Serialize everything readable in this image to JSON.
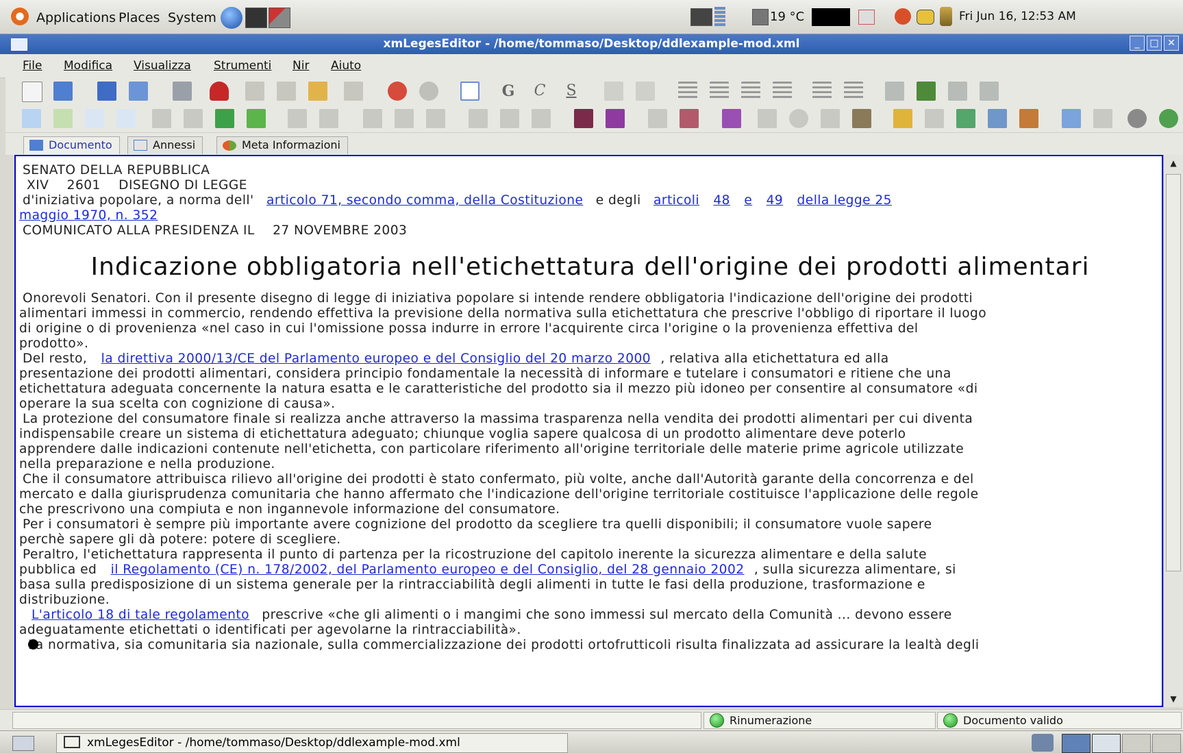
{
  "panel": {
    "menus": [
      "Applications",
      "Places",
      "System"
    ],
    "temperature": "19 °C",
    "clock": "Fri Jun 16, 12:53 AM"
  },
  "window": {
    "title": "xmLegesEditor - /home/tommaso/Desktop/ddlexample-mod.xml"
  },
  "menubar": [
    "File",
    "Modifica",
    "Visualizza",
    "Strumenti",
    "Nir",
    "Aiuto"
  ],
  "toolbar": {
    "format_letters": [
      "G",
      "C",
      "S"
    ]
  },
  "tabs": [
    "Documento",
    "Annessi",
    "Meta Informazioni"
  ],
  "document": {
    "header1": "SENATO DELLA REPUBBLICA",
    "leg": "XIV",
    "num": "2601",
    "type": "DISEGNO DI LEGGE",
    "initiative_pre": "d'iniziativa popolare, a norma dell'",
    "link_costituzione": "articolo 71, secondo comma, della Costituzione",
    "initiative_mid": "e degli",
    "link_articoli": "articoli",
    "link_48": "48",
    "link_e": "e",
    "link_49": "49",
    "link_legge": "della legge 25",
    "link_legge_cont": "maggio 1970, n. 352",
    "comunicato_label": "COMUNICATO ALLA PRESIDENZA IL",
    "comunicato_date": "27 NOVEMBRE 2003",
    "title": "Indicazione obbligatoria nell'etichettatura dell'origine dei prodotti alimentari",
    "p1_l1": "Onorevoli Senatori. Con il presente disegno di legge di iniziativa popolare si intende rendere obbligatoria l'indicazione dell'origine dei prodotti",
    "p1_l2": "alimentari immessi in commercio, rendendo effettiva la previsione della normativa sulla etichettatura che prescrive l'obbligo di riportare il luogo",
    "p1_l3": "di origine o di provenienza «nel caso in cui l'omissione possa indurre in errore l'acquirente circa l'origine o la provenienza effettiva del",
    "p1_l4": "prodotto».",
    "p2_pre": "Del resto,",
    "p2_link": "la direttiva 2000/13/CE del Parlamento europeo e del Consiglio del 20 marzo 2000",
    "p2_post": ", relativa alla etichettatura ed alla",
    "p2_l2": "presentazione dei prodotti alimentari, considera principio fondamentale la necessità di informare e tutelare i consumatori e ritiene che una",
    "p2_l3": "etichettatura adeguata concernente la natura esatta e le caratteristiche del prodotto sia il mezzo più idoneo per consentire al consumatore «di",
    "p2_l4": "operare la sua scelta con cognizione di causa».",
    "p3_l1": "La protezione del consumatore finale si realizza anche attraverso la massima trasparenza nella vendita dei prodotti alimentari per cui diventa",
    "p3_l2": "indispensabile creare un sistema di etichettatura adeguato; chiunque voglia sapere qualcosa di un prodotto alimentare deve poterlo",
    "p3_l3": "apprendere dalle indicazioni contenute nell'etichetta, con particolare riferimento all'origine territoriale delle materie prime agricole utilizzate",
    "p3_l4": "nella preparazione e nella produzione.",
    "p4_l1": "Che il consumatore attribuisca rilievo all'origine dei prodotti è stato confermato, più volte, anche dall'Autorità garante della concorrenza e del",
    "p4_l2": "mercato e dalla giurisprudenza comunitaria che hanno affermato che l'indicazione dell'origine territoriale costituisce l'applicazione delle regole",
    "p4_l3": "che prescrivono una compiuta e non ingannevole informazione del consumatore.",
    "p5_l1": "Per i consumatori è sempre più importante avere cognizione del prodotto da scegliere tra quelli disponibili; il consumatore vuole sapere",
    "p5_l2": "perchè sapere gli dà potere: potere di scegliere.",
    "p6_l1": "Peraltro, l'etichettatura rappresenta il punto di partenza per la ricostruzione del capitolo inerente la sicurezza alimentare e della salute",
    "p6_pre": "pubblica ed",
    "p6_link": "il Regolamento (CE) n. 178/2002, del Parlamento europeo e del Consiglio, del 28 gennaio 2002",
    "p6_post": ", sulla sicurezza alimentare, si",
    "p6_l3": "basa sulla predisposizione di un sistema generale per la rintracciabilità degli alimenti in tutte le fasi della produzione, trasformazione e",
    "p6_l4": "distribuzione.",
    "p7_link": "L'articolo 18 di tale regolamento",
    "p7_post": "prescrive «che gli alimenti o i mangimi che sono immessi sul mercato della Comunità ... devono essere",
    "p7_l2": "adeguatamente etichettati o identificati per agevolarne la rintracciabilità».",
    "p8_l1": "La normativa, sia comunitaria sia nazionale, sulla commercializzazione dei prodotti ortofrutticoli risulta finalizzata ad assicurare la lealtà degli"
  },
  "status": {
    "rinumerazione": "Rinumerazione",
    "valid": "Documento valido"
  },
  "taskbar": {
    "task": "xmLegesEditor - /home/tommaso/Desktop/ddlexample-mod.xml"
  },
  "colors": {
    "link": "#1c2bd6",
    "title_bar": "#2f5cad",
    "editor_border": "#0000cc"
  }
}
